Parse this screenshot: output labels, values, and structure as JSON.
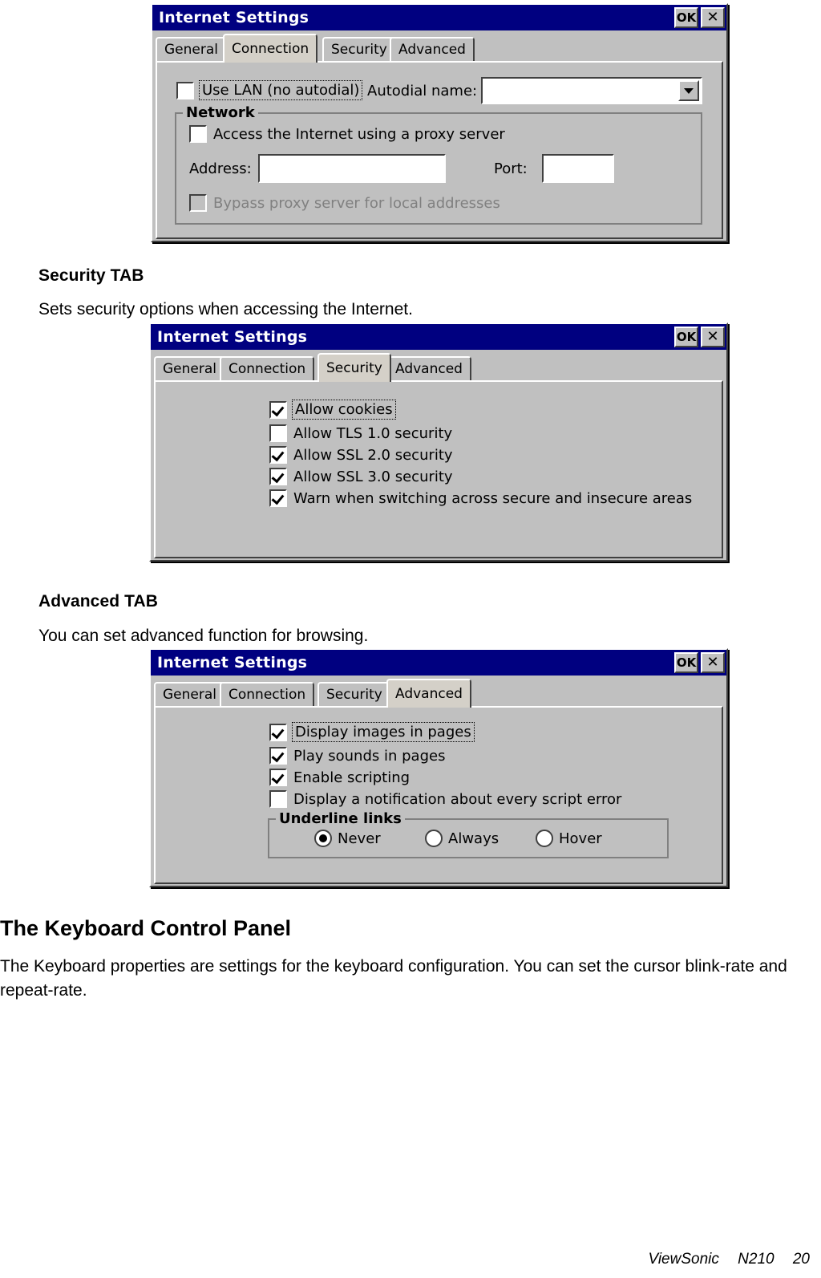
{
  "page": {
    "footer": {
      "brand": "ViewSonic",
      "model": "N210",
      "page_number": "20"
    }
  },
  "sections": [
    {
      "heading": "Security TAB",
      "description": "Sets security options when accessing the Internet."
    },
    {
      "heading": "Advanced TAB",
      "description": "You can set advanced function for browsing."
    }
  ],
  "keyboard_section": {
    "heading": "The Keyboard Control Panel",
    "paragraph": "The Keyboard properties are settings for the keyboard configuration. You can set the cursor blink-rate and repeat-rate."
  },
  "dialogs": {
    "connection": {
      "title": "Internet Settings",
      "buttons": {
        "ok": "OK",
        "close": "✕"
      },
      "tabs": [
        {
          "label": "General",
          "active": false
        },
        {
          "label": "Connection",
          "active": true
        },
        {
          "label": "Security",
          "active": false
        },
        {
          "label": "Advanced",
          "active": false
        }
      ],
      "use_lan_checkbox": {
        "label": "Use LAN (no autodial)",
        "checked": false,
        "focused": true
      },
      "autodial_label": "Autodial name:",
      "autodial_value": "",
      "network_group": {
        "title": "Network",
        "proxy_checkbox": {
          "label": "Access the Internet using a proxy server",
          "checked": false
        },
        "address_label": "Address:",
        "address_value": "",
        "port_label": "Port:",
        "port_value": "",
        "bypass_checkbox": {
          "label": "Bypass proxy server for local addresses",
          "checked": false,
          "disabled": true
        }
      }
    },
    "security": {
      "title": "Internet Settings",
      "buttons": {
        "ok": "OK",
        "close": "✕"
      },
      "tabs": [
        {
          "label": "General",
          "active": false
        },
        {
          "label": "Connection",
          "active": false
        },
        {
          "label": "Security",
          "active": true
        },
        {
          "label": "Advanced",
          "active": false
        }
      ],
      "options": [
        {
          "label": "Allow cookies",
          "checked": true,
          "focused": true
        },
        {
          "label": "Allow TLS 1.0 security",
          "checked": false,
          "focused": false
        },
        {
          "label": "Allow SSL 2.0 security",
          "checked": true,
          "focused": false
        },
        {
          "label": "Allow SSL 3.0 security",
          "checked": true,
          "focused": false
        },
        {
          "label": "Warn when switching across secure and insecure areas",
          "checked": true,
          "focused": false
        }
      ]
    },
    "advanced": {
      "title": "Internet Settings",
      "buttons": {
        "ok": "OK",
        "close": "✕"
      },
      "tabs": [
        {
          "label": "General",
          "active": false
        },
        {
          "label": "Connection",
          "active": false
        },
        {
          "label": "Security",
          "active": false
        },
        {
          "label": "Advanced",
          "active": true
        }
      ],
      "options": [
        {
          "label": "Display images in pages",
          "checked": true,
          "focused": true
        },
        {
          "label": "Play sounds in pages",
          "checked": true,
          "focused": false
        },
        {
          "label": "Enable scripting",
          "checked": true,
          "focused": false
        },
        {
          "label": "Display a notification about every script error",
          "checked": false,
          "focused": false
        }
      ],
      "underline_group": {
        "title": "Underline links",
        "options": [
          {
            "label": "Never",
            "selected": true
          },
          {
            "label": "Always",
            "selected": false
          },
          {
            "label": "Hover",
            "selected": false
          }
        ]
      }
    }
  }
}
